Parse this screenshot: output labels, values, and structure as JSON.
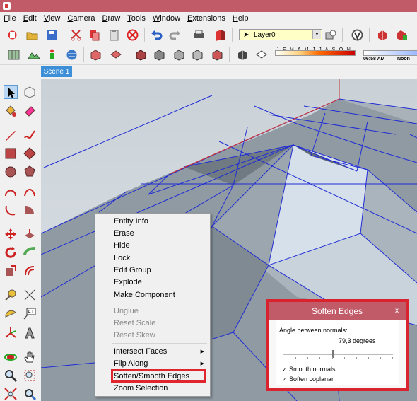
{
  "menu": [
    {
      "accel": "F",
      "rest": "ile"
    },
    {
      "accel": "E",
      "rest": "dit"
    },
    {
      "accel": "V",
      "rest": "iew"
    },
    {
      "accel": "C",
      "rest": "amera"
    },
    {
      "accel": "D",
      "rest": "raw"
    },
    {
      "accel": "T",
      "rest": "ools"
    },
    {
      "accel": "W",
      "rest": "indow"
    },
    {
      "accel": "E",
      "rest": "xtensions"
    },
    {
      "accel": "H",
      "rest": "elp"
    }
  ],
  "layer": {
    "current": "Layer0"
  },
  "shadow": {
    "months": "J F M A M J J A S O N D",
    "time1": "06:58 AM",
    "time2": "Noon"
  },
  "scene": {
    "tab": "Scene 1"
  },
  "context_menu": {
    "items": [
      {
        "label": "Entity Info",
        "enabled": true
      },
      {
        "label": "Erase",
        "enabled": true
      },
      {
        "label": "Hide",
        "enabled": true
      },
      {
        "label": "Lock",
        "enabled": true
      },
      {
        "label": "Edit Group",
        "enabled": true
      },
      {
        "label": "Explode",
        "enabled": true
      },
      {
        "label": "Make Component",
        "enabled": true
      },
      {
        "label": "Unglue",
        "enabled": false
      },
      {
        "label": "Reset Scale",
        "enabled": false
      },
      {
        "label": "Reset Skew",
        "enabled": false
      },
      {
        "label": "Intersect Faces",
        "enabled": true,
        "submenu": true
      },
      {
        "label": "Flip Along",
        "enabled": true,
        "submenu": true
      },
      {
        "label": "Soften/Smooth Edges",
        "enabled": true,
        "highlighted": true
      },
      {
        "label": "Zoom Selection",
        "enabled": true
      }
    ]
  },
  "soften_dialog": {
    "title": "Soften Edges",
    "close": "x",
    "angle_label": "Angle between normals:",
    "angle_value": "79,3  degrees",
    "angle_degrees": 79.3,
    "smooth_normals": {
      "label": "Smooth normals",
      "checked": true
    },
    "soften_coplanar": {
      "label": "Soften coplanar",
      "checked": true
    }
  },
  "colors": {
    "title_bar": "#c25b68",
    "highlight": "#e0252e",
    "edge": "#1f2bd6",
    "face_gray": "#8f9aa3",
    "face_light": "#d6e0ea"
  }
}
